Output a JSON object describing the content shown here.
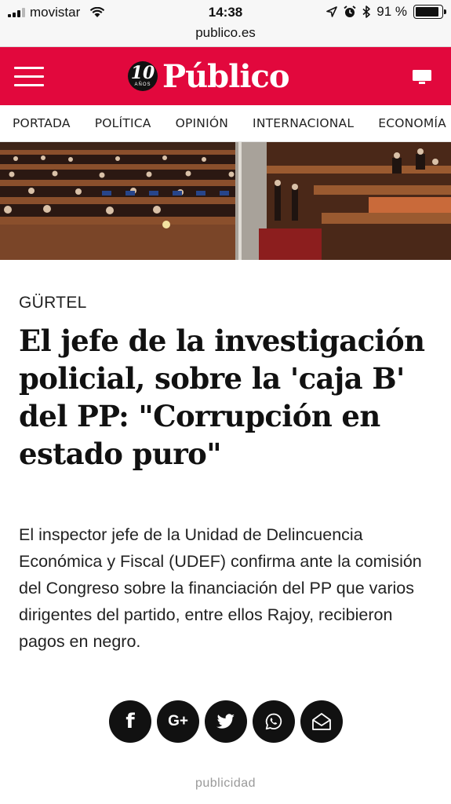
{
  "status_bar": {
    "carrier": "movistar",
    "time": "14:38",
    "battery_text": "91 %",
    "battery_level": 0.91
  },
  "browser": {
    "url": "publico.es"
  },
  "header": {
    "menu_icon": "hamburger-icon",
    "logo_number": "10",
    "logo_years": "AÑOS",
    "logo_text": "Público",
    "desktop_icon": "desktop-icon",
    "brand_color": "#e2083d"
  },
  "nav": {
    "items": [
      "PORTADA",
      "POLÍTICA",
      "OPINIÓN",
      "INTERNACIONAL",
      "ECONOMÍA"
    ]
  },
  "article": {
    "kicker": "GÜRTEL",
    "headline": "El jefe de la investigación policial, sobre la 'caja B' del PP: \"Corrupción en estado puro\"",
    "lede": "El inspector jefe de la Unidad de Delincuencia Económica y Fiscal (UDEF) confirma ante la comisión del Congreso sobre la financiación del PP que varios dirigentes del partido, entre ellos Rajoy, recibieron pagos en negro."
  },
  "share": {
    "buttons": [
      {
        "icon": "facebook-icon",
        "glyph": "f"
      },
      {
        "icon": "google-plus-icon",
        "glyph": "G+"
      },
      {
        "icon": "twitter-icon"
      },
      {
        "icon": "whatsapp-icon"
      },
      {
        "icon": "email-icon"
      }
    ]
  },
  "ad_label": "publicidad"
}
